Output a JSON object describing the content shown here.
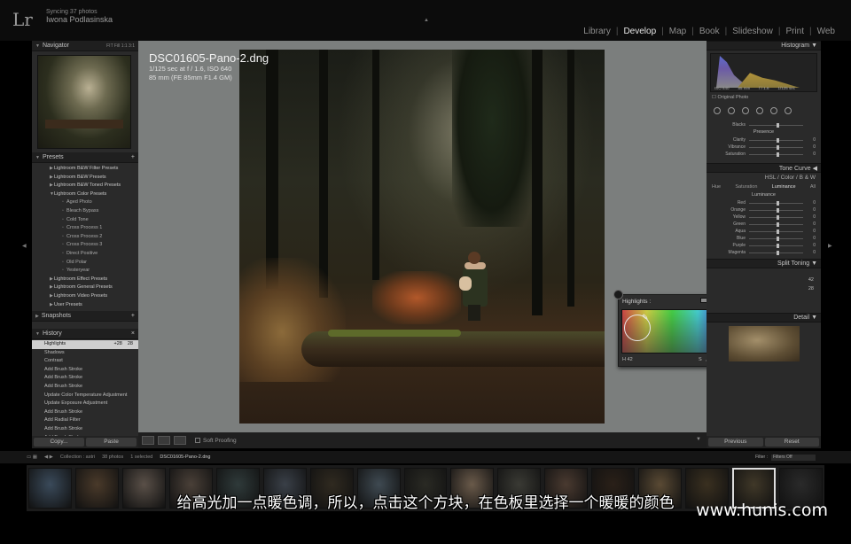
{
  "topbar": {
    "logo": "Lr",
    "identity_line1": "Syncing 37 photos",
    "identity_line2": "Iwona Podlasinska",
    "modules": [
      "Library",
      "Develop",
      "Map",
      "Book",
      "Slideshow",
      "Print",
      "Web"
    ],
    "active_module": "Develop"
  },
  "navigator": {
    "title": "Navigator",
    "zoom_options": "FIT  Fill  1:1  3:1"
  },
  "presets": {
    "title": "Presets",
    "items": [
      {
        "label": "Lightroom B&W Filter Presets",
        "type": "folder"
      },
      {
        "label": "Lightroom B&W Presets",
        "type": "folder"
      },
      {
        "label": "Lightroom B&W Toned Presets",
        "type": "folder"
      },
      {
        "label": "Lightroom Color Presets",
        "type": "folder"
      },
      {
        "label": "Aged Photo",
        "type": "child"
      },
      {
        "label": "Bleach Bypass",
        "type": "child"
      },
      {
        "label": "Cold Tone",
        "type": "child"
      },
      {
        "label": "Cross Process 1",
        "type": "child"
      },
      {
        "label": "Cross Process 2",
        "type": "child"
      },
      {
        "label": "Cross Process 3",
        "type": "child"
      },
      {
        "label": "Direct Positive",
        "type": "child"
      },
      {
        "label": "Old Polar",
        "type": "child"
      },
      {
        "label": "Yesteryear",
        "type": "child"
      },
      {
        "label": "Lightroom Effect Presets",
        "type": "folder"
      },
      {
        "label": "Lightroom General Presets",
        "type": "folder"
      },
      {
        "label": "Lightroom Video Presets",
        "type": "folder"
      },
      {
        "label": "User Presets",
        "type": "folder"
      }
    ]
  },
  "snapshots": {
    "title": "Snapshots"
  },
  "history": {
    "title": "History",
    "items": [
      {
        "label": "Highlights",
        "v1": "+28",
        "v2": "28",
        "selected": true
      },
      {
        "label": "Shadows",
        "v1": "",
        "v2": "",
        "selected": false
      },
      {
        "label": "Contrast",
        "v1": "",
        "v2": "",
        "selected": false
      },
      {
        "label": "Add Brush Stroke",
        "v1": "",
        "v2": "",
        "selected": false
      },
      {
        "label": "Add Brush Stroke",
        "v1": "",
        "v2": "",
        "selected": false
      },
      {
        "label": "Add Brush Stroke",
        "v1": "",
        "v2": "",
        "selected": false
      },
      {
        "label": "Update Color Temperature Adjustment",
        "v1": "",
        "v2": "",
        "selected": false
      },
      {
        "label": "Update Exposure Adjustment",
        "v1": "",
        "v2": "",
        "selected": false
      },
      {
        "label": "Add Brush Stroke",
        "v1": "",
        "v2": "",
        "selected": false
      },
      {
        "label": "Add Radial Filter",
        "v1": "",
        "v2": "",
        "selected": false
      },
      {
        "label": "Add Brush Stroke",
        "v1": "",
        "v2": "",
        "selected": false
      },
      {
        "label": "Add Brush Stroke",
        "v1": "",
        "v2": "",
        "selected": false
      }
    ]
  },
  "left_buttons": {
    "copy": "Copy...",
    "paste": "Paste"
  },
  "photo": {
    "filename": "DSC01605-Pano-2.dng",
    "meta_line1": "1/125 sec at f / 1.6, ISO 640",
    "meta_line2": "85 mm (FE 85mm F1.4 GM)"
  },
  "picker": {
    "title": "Highlights :",
    "h_label": "H",
    "h_value": "42",
    "s_label": "S",
    "s_value": "28",
    "swatch_colors": [
      "#8a8a8a",
      "#a09070",
      "#7080a0",
      "#909090",
      "#6f6f6f"
    ],
    "current_color": "#9a8a7a"
  },
  "toolbar": {
    "soft_proofing": "Soft Proofing"
  },
  "right": {
    "histogram_title": "Histogram",
    "hist_info": [
      "ISO 640",
      "85 mm",
      "f / 1.6",
      "1/125 sec"
    ],
    "original_photo": "Original Photo",
    "presence_title": "Presence",
    "sliders_top": [
      {
        "label": "Blacks",
        "value": ""
      },
      {
        "label": "Clarity",
        "value": "0"
      },
      {
        "label": "Vibrance",
        "value": "0"
      },
      {
        "label": "Saturation",
        "value": "0"
      }
    ],
    "tone_curve": "Tone Curve",
    "hsl_head": "HSL  /  Color  /  B & W",
    "hsl_tabs": [
      "Hue",
      "Saturation",
      "Luminance",
      "All"
    ],
    "luminance_title": "Luminance",
    "sliders_lum": [
      {
        "label": "Red",
        "value": "0"
      },
      {
        "label": "Orange",
        "value": "0"
      },
      {
        "label": "Yellow",
        "value": "0"
      },
      {
        "label": "Green",
        "value": "0"
      },
      {
        "label": "Aqua",
        "value": "0"
      },
      {
        "label": "Blue",
        "value": "0"
      },
      {
        "label": "Purple",
        "value": "0"
      },
      {
        "label": "Magenta",
        "value": "0"
      }
    ],
    "split_toning": "Split Toning",
    "split_values": [
      "42",
      "28"
    ],
    "detail": "Detail",
    "previous": "Previous",
    "reset": "Reset"
  },
  "filmbar": {
    "collection": "Collection : astri",
    "count": "38 photos",
    "selected": "1 selected",
    "current_file": "DSC01605-Pano-2.dng",
    "filter_label": "Filter :",
    "filter_value": "Filters Off"
  },
  "filmstrip": {
    "thumbs": [
      "#3a4a5a",
      "#4a3a2a",
      "#5a5048",
      "#4a4038",
      "#2f3a3a",
      "#3a4048",
      "#302a20",
      "#3f4a52",
      "#2a2a24",
      "#6a5a4a",
      "#3a3a34",
      "#4a3a30",
      "#2a2018",
      "#5a4a34",
      "#3a3020",
      "#403828",
      "#2a2a2a"
    ],
    "selected_index": 15
  },
  "subtitle": "给高光加一点暖色调，所以，点击这个方块，在色板里选择一个暖暖的颜色",
  "watermark": "www.hunis.com"
}
